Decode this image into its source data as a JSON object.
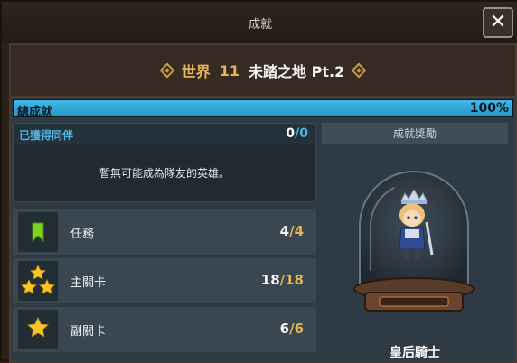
{
  "window": {
    "title": "成就",
    "close_icon": "close-icon"
  },
  "world": {
    "label": "世界",
    "number": "11",
    "name": "未踏之地 Pt.2"
  },
  "total_progress": {
    "label": "總成就",
    "percent_text": "100%",
    "fill_fraction": 1.0
  },
  "companions": {
    "label": "已獲得同伴",
    "current": "0",
    "total": "0",
    "empty_message": "暫無可能成為隊友的英雄。"
  },
  "achievements": [
    {
      "icon": "bookmark-icon",
      "label": "任務",
      "current": "4",
      "total": "4"
    },
    {
      "icon": "three-stars-icon",
      "label": "主關卡",
      "current": "18",
      "total": "18"
    },
    {
      "icon": "star-icon",
      "label": "副關卡",
      "current": "6",
      "total": "6"
    }
  ],
  "reward": {
    "header": "成就獎勵",
    "hero_name": "皇后騎士"
  },
  "colors": {
    "accent_gold": "#e3b45a",
    "progress_blue": "#2ea8dc",
    "label_blue": "#4fb4e0"
  }
}
